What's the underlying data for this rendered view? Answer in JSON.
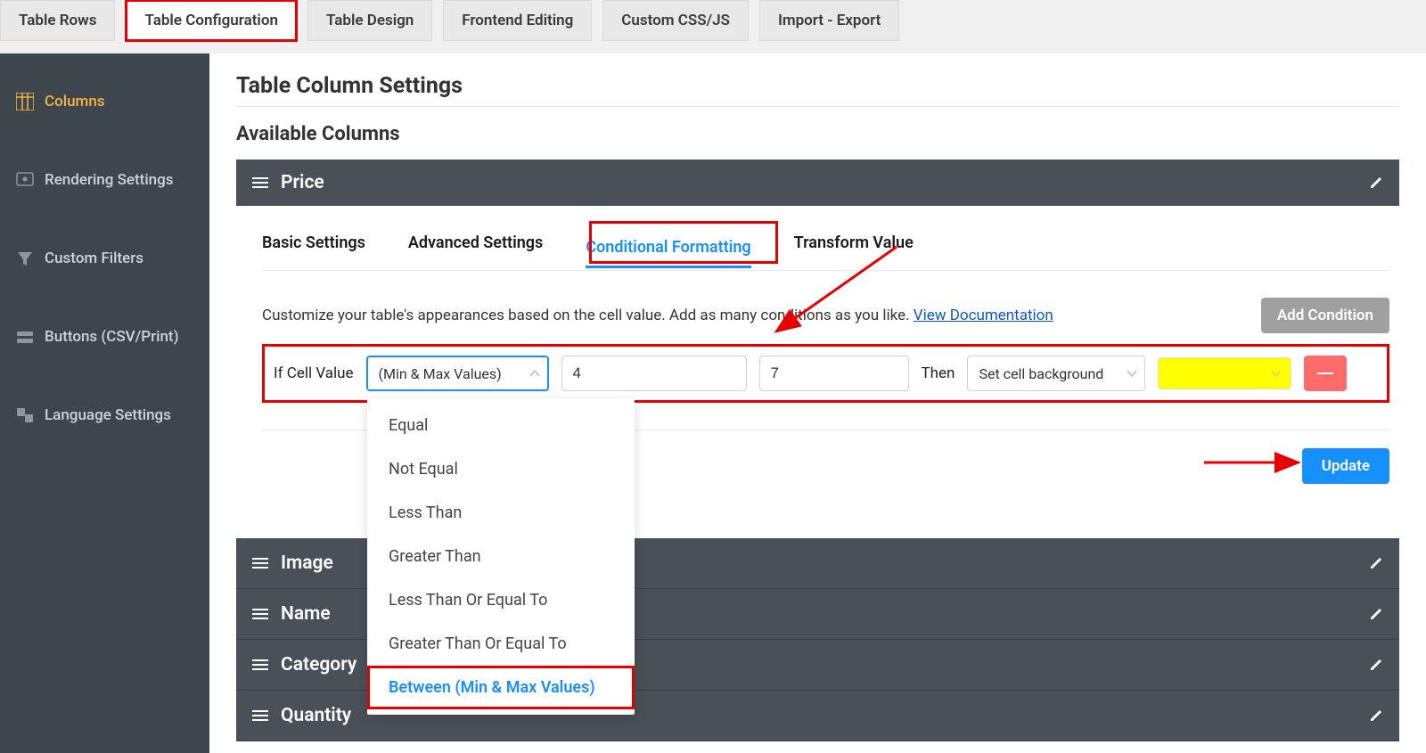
{
  "top_tabs": {
    "rows": "Table Rows",
    "configuration": "Table Configuration",
    "design": "Table Design",
    "frontend": "Frontend Editing",
    "css": "Custom CSS/JS",
    "import": "Import - Export"
  },
  "sidebar": {
    "columns": "Columns",
    "rendering": "Rendering Settings",
    "filters": "Custom Filters",
    "buttons": "Buttons (CSV/Print)",
    "language": "Language Settings"
  },
  "page": {
    "title": "Table Column Settings",
    "section": "Available Columns"
  },
  "column_panel": {
    "title": "Price"
  },
  "inner_tabs": {
    "basic": "Basic Settings",
    "advanced": "Advanced Settings",
    "conditional": "Conditional Formatting",
    "transform": "Transform Value"
  },
  "help": {
    "text_a": "Customize your table's appearances based on the cell value. Add as many conditions as you like. ",
    "link": "View Documentation",
    "add_btn": "Add Condition"
  },
  "condition": {
    "if_label": "If Cell Value",
    "operator_display": "(Min & Max Values)",
    "val1": "4",
    "val2": "7",
    "then_label": "Then",
    "action_display": "Set cell background",
    "color": "#ffff00"
  },
  "dropdown_options": [
    "Equal",
    "Not Equal",
    "Less Than",
    "Greater Than",
    "Less Than Or Equal To",
    "Greater Than Or Equal To",
    "Between (Min & Max Values)"
  ],
  "dropdown_selected_index": 6,
  "update_btn": "Update",
  "lower_columns": [
    "Image",
    "Name",
    "Category",
    "Quantity"
  ]
}
